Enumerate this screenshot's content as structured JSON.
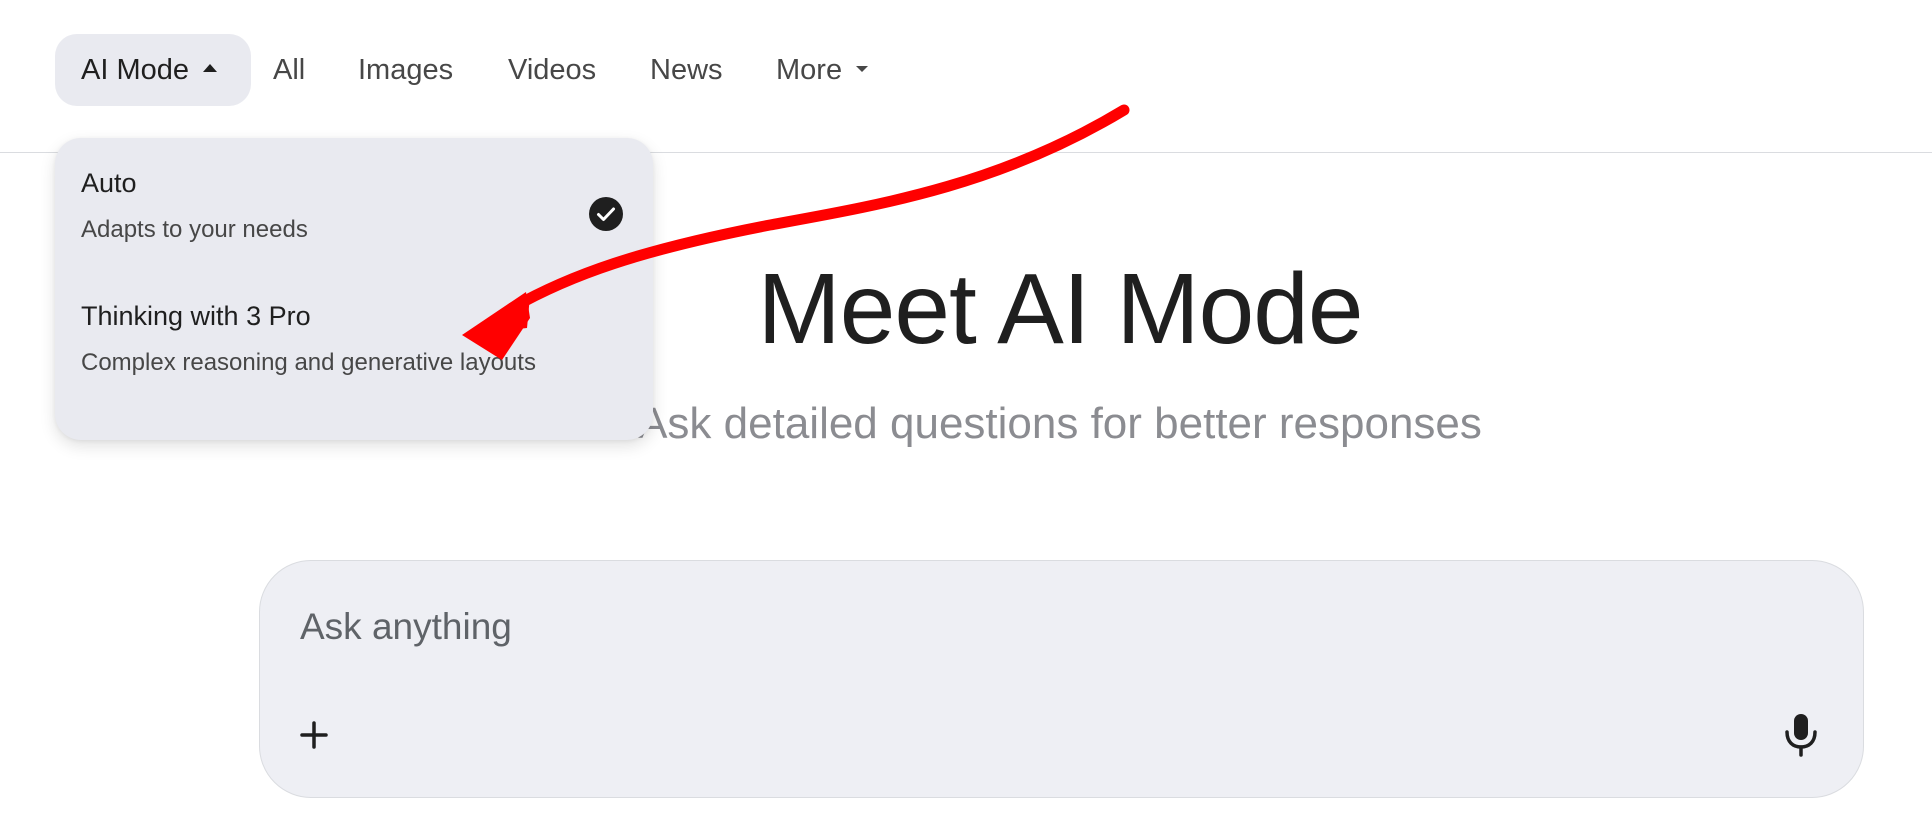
{
  "nav": {
    "tabs": [
      {
        "label": "AI Mode",
        "active": true
      },
      {
        "label": "All"
      },
      {
        "label": "Images"
      },
      {
        "label": "Videos"
      },
      {
        "label": "News"
      },
      {
        "label": "More"
      }
    ]
  },
  "dropdown": {
    "options": [
      {
        "title": "Auto",
        "description": "Adapts to your needs",
        "selected": true,
        "icon": "check-circle-icon"
      },
      {
        "title": "Thinking with 3 Pro",
        "description": "Complex reasoning and generative layouts",
        "selected": false
      }
    ]
  },
  "hero": {
    "title": "Meet AI Mode",
    "subtitle": "Ask detailed questions for better responses"
  },
  "search": {
    "placeholder": "Ask anything",
    "value": "",
    "add_icon": "plus-icon",
    "mic_icon": "microphone-icon"
  },
  "colors": {
    "accent_annotation": "#ff0000",
    "pill_background": "#e9eaf0",
    "search_background": "#eeeff4"
  }
}
